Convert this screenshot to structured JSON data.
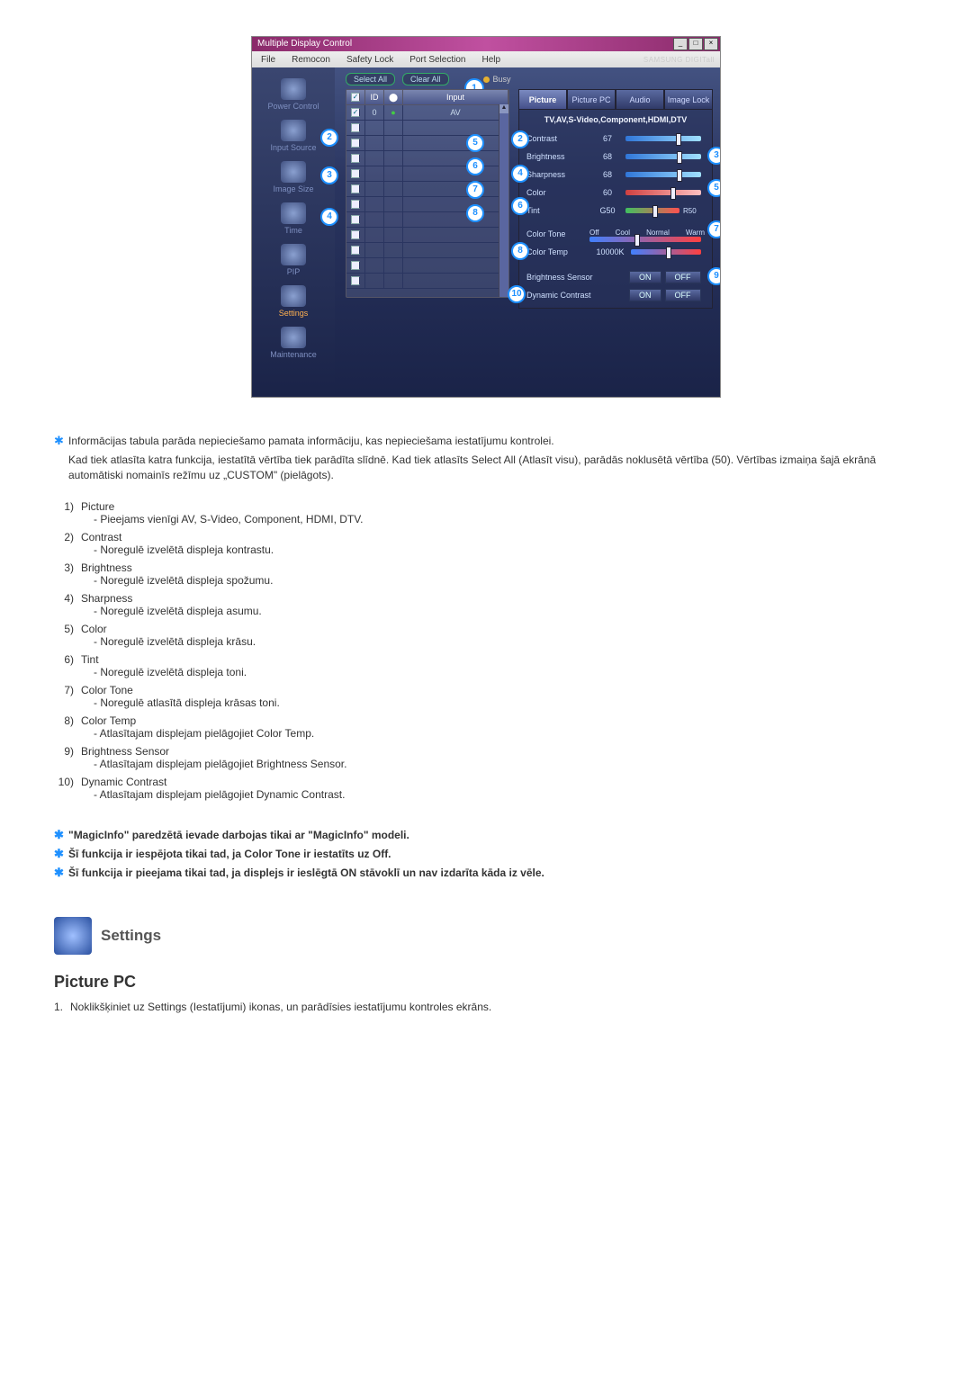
{
  "app_title": "Multiple Display Control",
  "menubar": [
    "File",
    "Remocon",
    "Safety Lock",
    "Port Selection",
    "Help"
  ],
  "brand": "SAMSUNG DIGITall",
  "sidebar": {
    "items": [
      {
        "label": "Power Control",
        "selected": false
      },
      {
        "label": "Input Source",
        "selected": false
      },
      {
        "label": "Image Size",
        "selected": false
      },
      {
        "label": "Time",
        "selected": false
      },
      {
        "label": "PIP",
        "selected": false
      },
      {
        "label": "Settings",
        "selected": true
      },
      {
        "label": "Maintenance",
        "selected": false
      }
    ]
  },
  "top": {
    "select_all": "Select All",
    "clear_all": "Clear All",
    "busy": "Busy"
  },
  "grid": {
    "headers": {
      "chk": "",
      "id": "ID",
      "power": "",
      "input": "Input"
    },
    "rows": [
      {
        "checked": true,
        "id": "0",
        "power": "●",
        "input": "AV"
      }
    ]
  },
  "tabs": [
    {
      "label": "Picture",
      "active": true
    },
    {
      "label": "Picture PC",
      "active": false
    },
    {
      "label": "Audio",
      "active": false
    },
    {
      "label": "Image Lock",
      "active": false
    }
  ],
  "panel_subtitle": "TV,AV,S-Video,Component,HDMI,DTV",
  "params": {
    "contrast": {
      "label": "Contrast",
      "value": "67"
    },
    "brightness": {
      "label": "Brightness",
      "value": "68"
    },
    "sharpness": {
      "label": "Sharpness",
      "value": "68"
    },
    "color": {
      "label": "Color",
      "value": "60"
    },
    "tint": {
      "label": "Tint",
      "value": "G50",
      "right": "R50"
    },
    "color_tone": {
      "label": "Color Tone",
      "opts": [
        "Off",
        "Cool",
        "Normal",
        "Warm"
      ]
    },
    "color_temp": {
      "label": "Color Temp",
      "value": "10000K"
    },
    "bsensor": {
      "label": "Brightness Sensor",
      "on": "ON",
      "off": "OFF"
    },
    "dcontrast": {
      "label": "Dynamic Contrast",
      "on": "ON",
      "off": "OFF"
    }
  },
  "big_badges": {
    "top": "1",
    "g2": "2",
    "g3": "3",
    "g4": "4",
    "r5": "5",
    "r6": "6",
    "r7": "7",
    "r8": "8",
    "p2": "2",
    "p3": "3",
    "p4": "4",
    "p5": "5",
    "p6": "6",
    "p7": "7",
    "p8": "8",
    "p9": "9",
    "p10": "10"
  },
  "intro": [
    "Informācijas tabula parāda nepieciešamo pamata informāciju, kas nepieciešama iestatījumu kontrolei.",
    "Kad tiek atlasīta katra funkcija, iestatītā vērtība tiek parādīta slīdnē. Kad tiek atlasīts Select All (Atlasīt visu), parādās noklusētā vērtība (50). Vērtības izmaiņa šajā ekrānā automātiski nomainīs režīmu uz „CUSTOM\" (pielāgots)."
  ],
  "list": [
    {
      "n": "1)",
      "t": "Picture",
      "d": "- Pieejams vienīgi AV, S-Video, Component, HDMI, DTV."
    },
    {
      "n": "2)",
      "t": "Contrast",
      "d": "- Noregulē izvelētā displeja kontrastu."
    },
    {
      "n": "3)",
      "t": "Brightness",
      "d": "- Noregulē izvelētā displeja spožumu."
    },
    {
      "n": "4)",
      "t": "Sharpness",
      "d": "- Noregulē izvelētā displeja asumu."
    },
    {
      "n": "5)",
      "t": "Color",
      "d": "- Noregulē izvelētā displeja krāsu."
    },
    {
      "n": "6)",
      "t": "Tint",
      "d": "- Noregulē izvelētā displeja toni."
    },
    {
      "n": "7)",
      "t": "Color Tone",
      "d": "- Noregulē atlasītā displeja krāsas toni."
    },
    {
      "n": "8)",
      "t": "Color Temp",
      "d": "- Atlasītajam displejam pielāgojiet Color Temp."
    },
    {
      "n": "9)",
      "t": "Brightness Sensor",
      "d": "- Atlasītajam displejam pielāgojiet Brightness Sensor."
    },
    {
      "n": "10)",
      "t": "Dynamic Contrast",
      "d": "- Atlasītajam displejam pielāgojiet Dynamic Contrast."
    }
  ],
  "star_notes": [
    "\"MagicInfo\" paredzētā ievade darbojas tikai ar \"MagicInfo\" modeli.",
    "Šī funkcija ir iespējota tikai tad, ja Color Tone ir iestatīts uz Off.",
    "Šī funkcija ir pieejama tikai tad, ja displejs ir ieslēgtā ON stāvoklī un nav izdarīta kāda iz vēle."
  ],
  "section": {
    "title": "Settings",
    "sub": "Picture PC"
  },
  "steps": [
    {
      "n": "1.",
      "t": "Noklikšķiniet uz Settings (Iestatījumi) ikonas, un parādīsies iestatījumu kontroles ekrāns."
    }
  ]
}
